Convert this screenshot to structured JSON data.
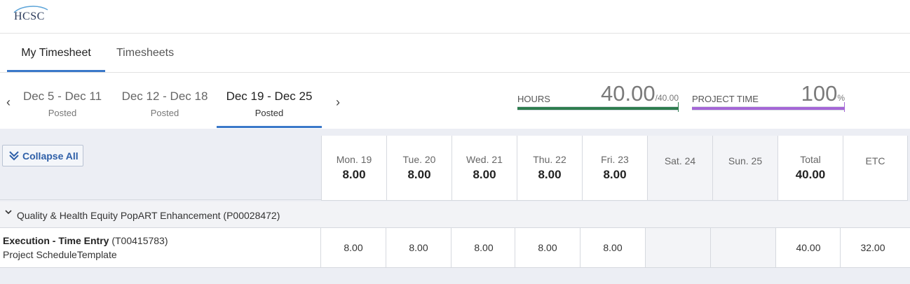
{
  "header": {
    "logo_text": "HCSC"
  },
  "tabs": [
    {
      "label": "My Timesheet",
      "active": true
    },
    {
      "label": "Timesheets",
      "active": false
    }
  ],
  "weeks": [
    {
      "range": "Dec 5 - Dec 11",
      "status": "Posted"
    },
    {
      "range": "Dec 12 - Dec 18",
      "status": "Posted"
    },
    {
      "range": "Dec 19 - Dec 25",
      "status": "Posted",
      "active": true
    }
  ],
  "hours_meter": {
    "label": "HOURS",
    "value": "40.00",
    "total": "/40.00",
    "fraction": 1.0,
    "color": "#2e7d4f"
  },
  "project_meter": {
    "label": "PROJECT TIME",
    "value": "100",
    "unit": "%",
    "fraction": 1.0,
    "color": "#a566d6"
  },
  "collapse_label": "Collapse All",
  "days": [
    {
      "name": "Mon. 19",
      "hours": "8.00"
    },
    {
      "name": "Tue. 20",
      "hours": "8.00"
    },
    {
      "name": "Wed. 21",
      "hours": "8.00"
    },
    {
      "name": "Thu. 22",
      "hours": "8.00"
    },
    {
      "name": "Fri. 23",
      "hours": "8.00"
    },
    {
      "name": "Sat. 24",
      "hours": ""
    },
    {
      "name": "Sun. 25",
      "hours": ""
    }
  ],
  "total": {
    "name": "Total",
    "hours": "40.00"
  },
  "etc": {
    "name": "ETC"
  },
  "project": {
    "title": "Quality & Health Equity PopART Enhancement (P00028472)"
  },
  "task": {
    "name": "Execution - Time Entry",
    "code": " (T00415783)",
    "template": "Project ScheduleTemplate",
    "entries": [
      "8.00",
      "8.00",
      "8.00",
      "8.00",
      "8.00",
      "",
      ""
    ],
    "total": "40.00",
    "etc": "32.00"
  }
}
